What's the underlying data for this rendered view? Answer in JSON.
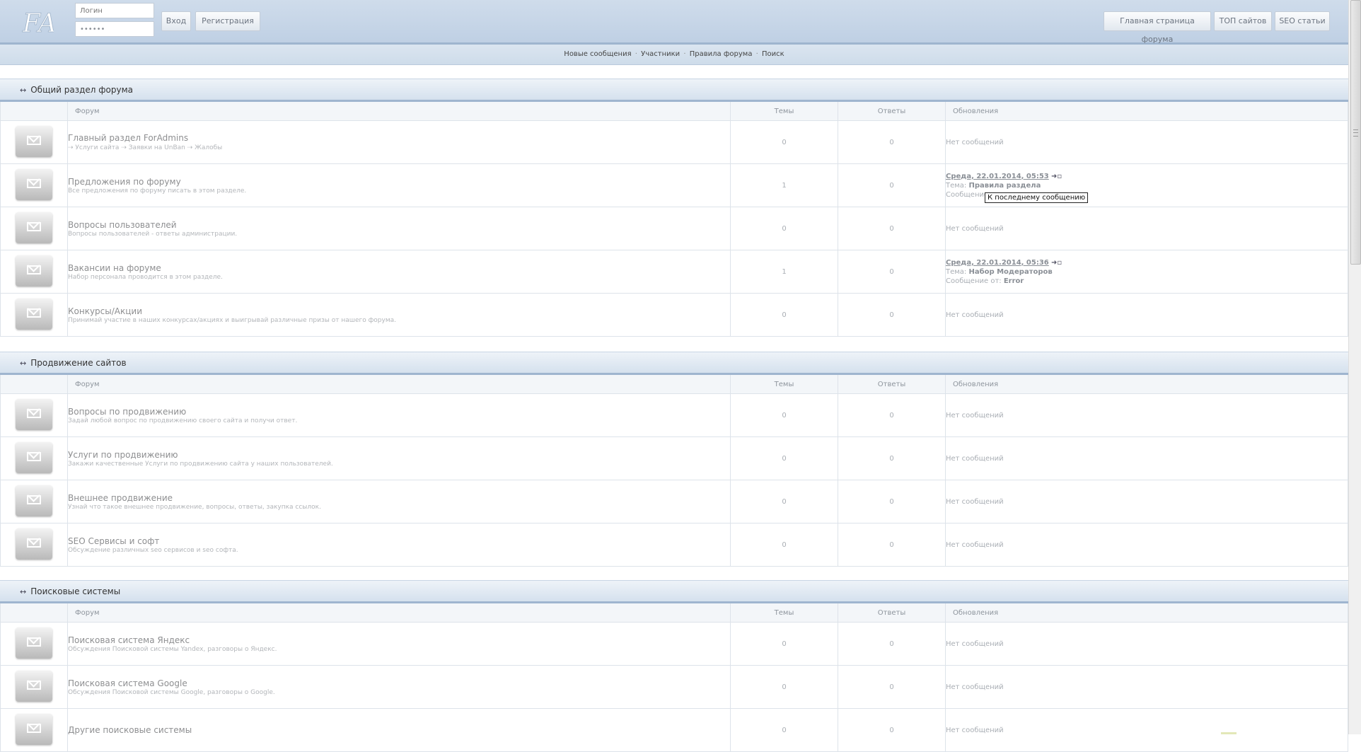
{
  "header": {
    "logo": "FA",
    "login_placeholder": "Логин",
    "password_value": "••••••",
    "login_button": "Вход",
    "register_button": "Регистрация",
    "nav": [
      "Главная страница форума",
      "ТОП сайтов",
      "SEO статьи"
    ]
  },
  "subnav": {
    "links": [
      "Новые сообщения",
      "Участники",
      "Правила форума",
      "Поиск"
    ],
    "separator": "·"
  },
  "columns": {
    "forum": "Форум",
    "topics": "Темы",
    "replies": "Ответы",
    "updates": "Обновления"
  },
  "no_messages": "Нет сообщений",
  "arrow": "↔",
  "goto_icon": "go-to-last-post-icon",
  "tooltip": "К последнему сообщению",
  "sections": [
    {
      "title": "Общий раздел форума",
      "forums": [
        {
          "title": "Главный раздел ForAdmins",
          "subforums": [
            "Услуги сайта",
            "Заявки на UnBan",
            "Жалобы"
          ],
          "topics": "0",
          "replies": "0"
        },
        {
          "title": "Предложения по форуму",
          "desc": "Все предложения по форуму писать в этом разделе.",
          "topics": "1",
          "replies": "0",
          "last": {
            "date": "Среда, 22.01.2014, 05:53",
            "topic_label": "Тема:",
            "topic": "Правила раздела",
            "author_label": "Сообщение от:"
          }
        },
        {
          "title": "Вопросы пользователей",
          "desc": "Вопросы пользователей - ответы администрации.",
          "topics": "0",
          "replies": "0"
        },
        {
          "title": "Вакансии на форуме",
          "desc": "Набор персонала проводится в этом разделе.",
          "topics": "1",
          "replies": "0",
          "last": {
            "date": "Среда, 22.01.2014, 05:36",
            "topic_label": "Тема:",
            "topic": "Набор Модераторов",
            "author_label": "Сообщение от:",
            "author": "Error"
          }
        },
        {
          "title": "Конкурсы/Акции",
          "desc": "Принимай участие в наших конкурсах/акциях и выигрывай различные призы от нашего форума.",
          "topics": "0",
          "replies": "0"
        }
      ]
    },
    {
      "title": "Продвижение сайтов",
      "forums": [
        {
          "title": "Вопросы по продвижению",
          "desc": "Задай любой вопрос по продвижению своего сайта и получи ответ.",
          "topics": "0",
          "replies": "0"
        },
        {
          "title": "Услуги по продвижению",
          "desc": "Закажи качественные Услуги по продвижению сайта у наших пользователей.",
          "topics": "0",
          "replies": "0"
        },
        {
          "title": "Внешнее продвижение",
          "desc": "Узнай что такое внешнее продвижение, вопросы, ответы, закупка ссылок.",
          "topics": "0",
          "replies": "0"
        },
        {
          "title": "SEO Сервисы и софт",
          "desc": "Обсуждение различных seo сервисов и seo софта.",
          "topics": "0",
          "replies": "0"
        }
      ]
    },
    {
      "title": "Поисковые системы",
      "forums": [
        {
          "title": "Поисковая система Яндекс",
          "desc": "Обсуждения Поисковой системы Yandex, разговоры о Яндекс.",
          "topics": "0",
          "replies": "0"
        },
        {
          "title": "Поисковая система Google",
          "desc": "Обсуждения Поисковой системы Google, разговоры о Google.",
          "topics": "0",
          "replies": "0"
        },
        {
          "title": "Другие поисковые системы",
          "desc": "",
          "topics": "0",
          "replies": "0"
        }
      ]
    }
  ],
  "colors": {
    "header_bg": "#c5d5e8",
    "section_border": "#9fb5cf",
    "text_muted": "#a9aeb4"
  }
}
